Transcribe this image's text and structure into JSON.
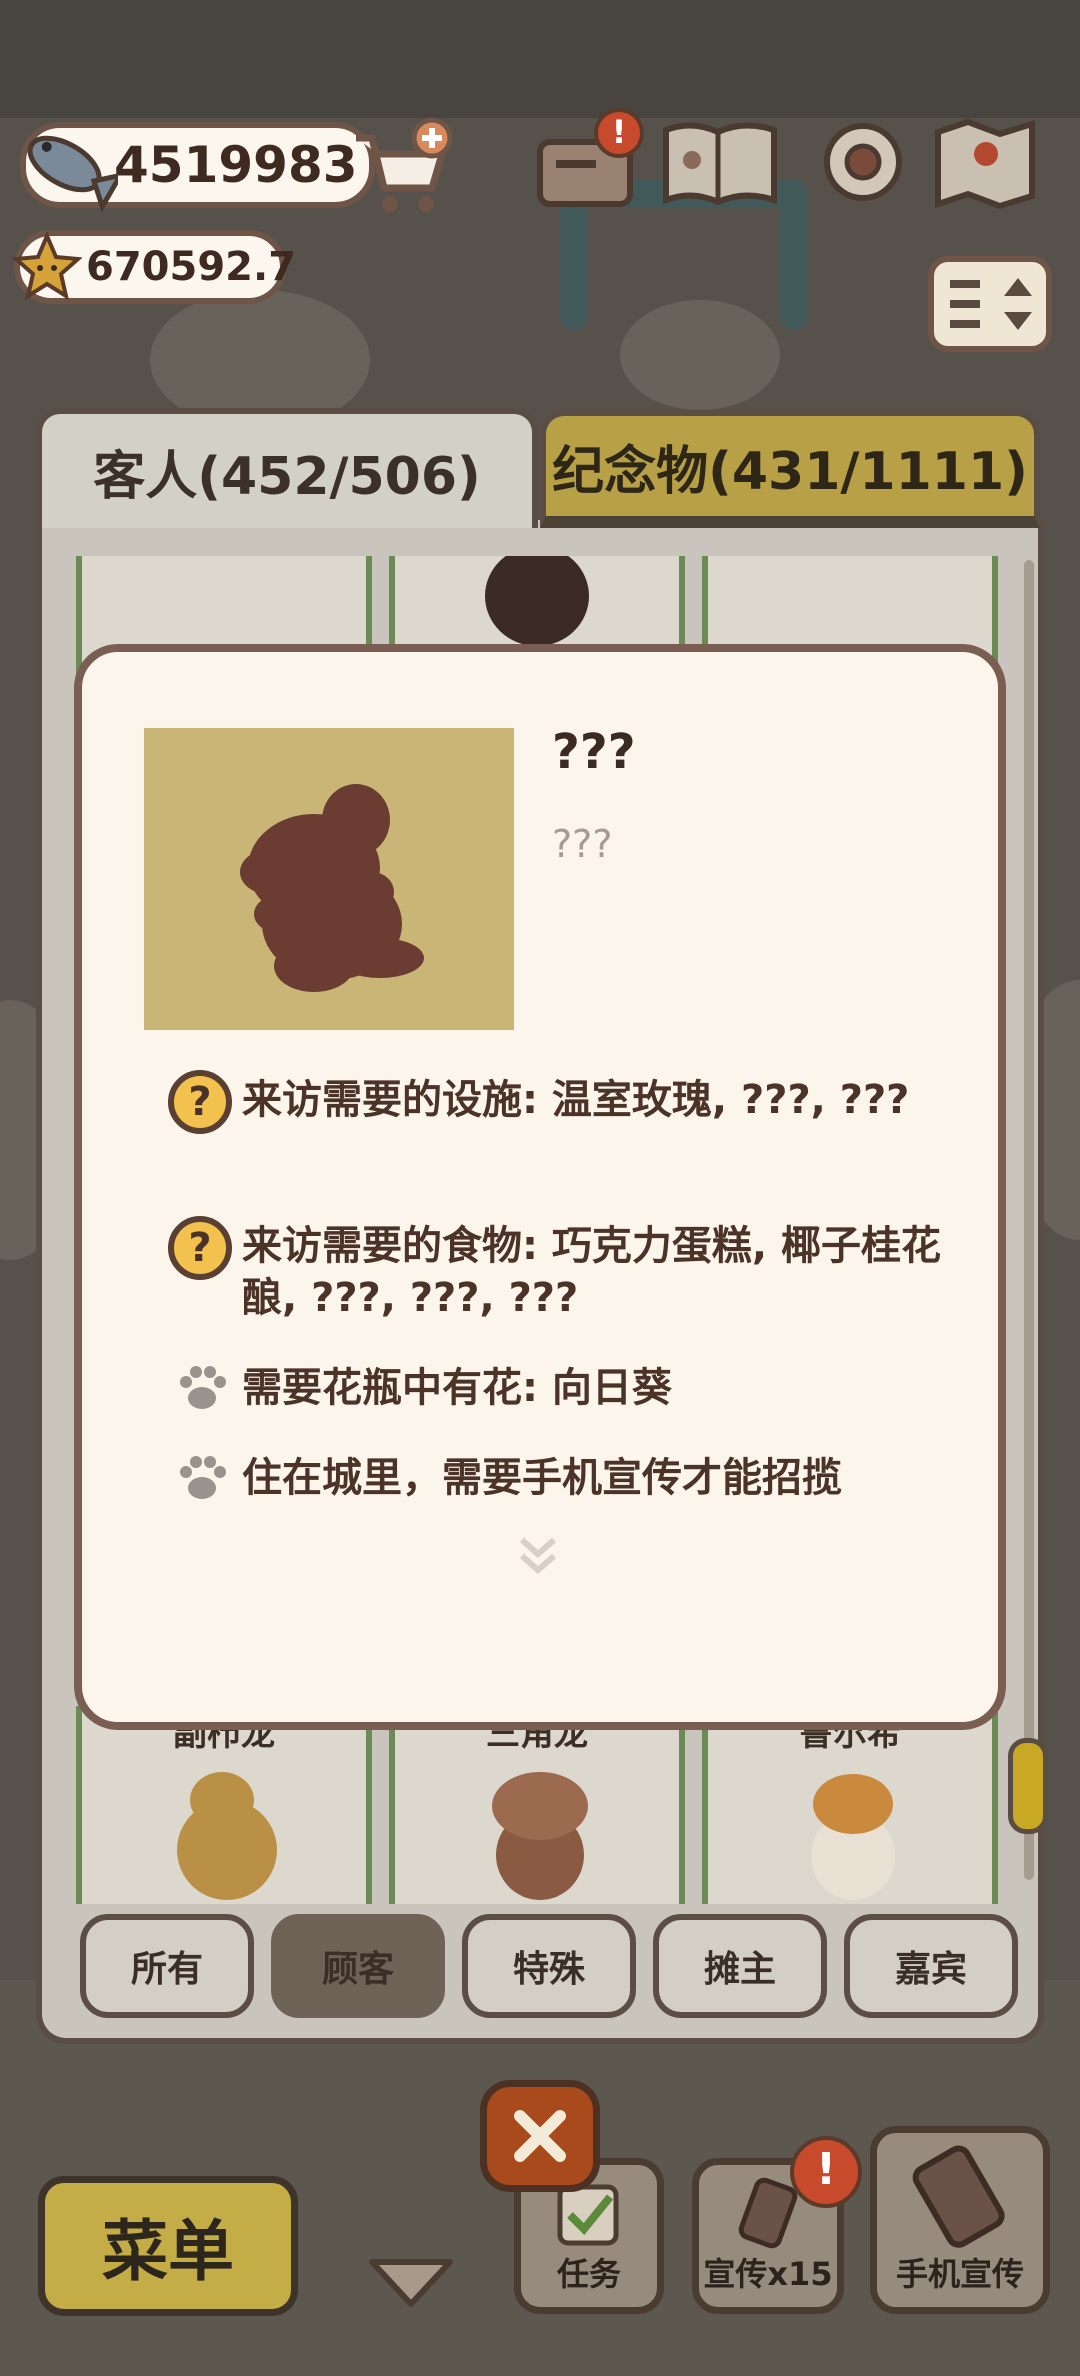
{
  "currency": {
    "fish": "4519983",
    "stars": "670592.7"
  },
  "tabs": {
    "guests": "客人(452/506)",
    "souvenirs": "纪念物(431/1111)"
  },
  "grid": {
    "row_bottom_names": [
      "副栉龙",
      "三角龙",
      "鲁尔希"
    ]
  },
  "filters": [
    {
      "label": "所有",
      "active": false
    },
    {
      "label": "顾客",
      "active": true
    },
    {
      "label": "特殊",
      "active": false
    },
    {
      "label": "摊主",
      "active": false
    },
    {
      "label": "嘉宾",
      "active": false
    }
  ],
  "bottom": {
    "menu": "菜单",
    "tasks": "任务",
    "promo_x15": "宣传x15",
    "phone_promo": "手机宣传"
  },
  "popup": {
    "title": "???",
    "subtitle": "???",
    "requirements": [
      {
        "icon": "question-icon",
        "text": "来访需要的设施: 温室玫瑰, ???, ???"
      },
      {
        "icon": "question-icon",
        "text": "来访需要的食物: 巧克力蛋糕, 椰子桂花酿, ???, ???, ???"
      },
      {
        "icon": "paw-icon",
        "text": "需要花瓶中有花: 向日葵"
      },
      {
        "icon": "paw-icon",
        "text": "住在城里，需要手机宣传才能招揽"
      }
    ]
  },
  "colors": {
    "popup_bg": "#fbf5ec",
    "portrait_bg": "#c9b677",
    "silhouette": "#6b3d32",
    "question_badge": "#f2c14e",
    "tab_gold": "#b7a046"
  }
}
